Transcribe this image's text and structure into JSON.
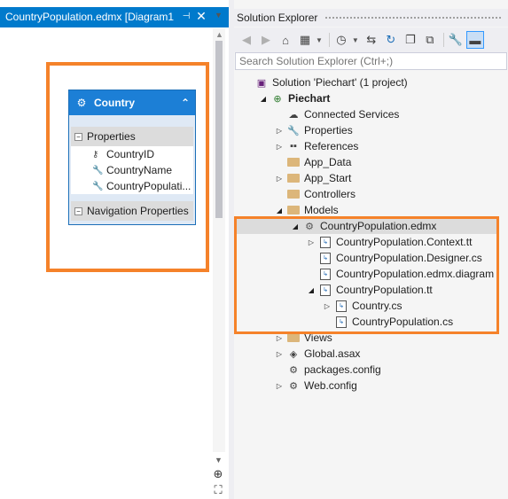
{
  "designer": {
    "tab_title": "CountryPopulation.edmx [Diagram1",
    "pin_icon": "pin-icon",
    "close_label": "✕",
    "entity": {
      "name": "Country",
      "properties_header": "Properties",
      "properties": [
        {
          "name": "CountryID",
          "icon": "key-icon"
        },
        {
          "name": "CountryName",
          "icon": "wrench-icon"
        },
        {
          "name": "CountryPopulati...",
          "icon": "wrench-icon"
        }
      ],
      "navigation_header": "Navigation Properties"
    },
    "highlight_color": "#f5822a"
  },
  "solution_explorer": {
    "title": "Solution Explorer",
    "search_placeholder": "Search Solution Explorer (Ctrl+;)",
    "toolbar": [
      "back-icon",
      "forward-icon",
      "home-icon",
      "switch-views-icon",
      "pending-changes-icon",
      "sync-icon",
      "refresh-icon",
      "collapse-all-icon",
      "show-all-files-icon",
      "properties-icon",
      "preview-icon"
    ],
    "tree": [
      {
        "label": "Solution 'Piechart' (1 project)",
        "icon": "solution-icon",
        "expander": "",
        "bold": false
      },
      {
        "label": "Piechart",
        "icon": "web-project-icon",
        "expander": "◢",
        "bold": true
      },
      {
        "label": "Connected Services",
        "icon": "cloud-icon",
        "expander": "",
        "bold": false
      },
      {
        "label": "Properties",
        "icon": "wrench-icon",
        "expander": "▷",
        "bold": false
      },
      {
        "label": "References",
        "icon": "references-icon",
        "expander": "▷",
        "bold": false
      },
      {
        "label": "App_Data",
        "icon": "folder-icon",
        "expander": "",
        "bold": false
      },
      {
        "label": "App_Start",
        "icon": "folder-icon",
        "expander": "▷",
        "bold": false
      },
      {
        "label": "Controllers",
        "icon": "folder-icon",
        "expander": "",
        "bold": false
      },
      {
        "label": "Models",
        "icon": "folder-icon",
        "expander": "◢",
        "bold": false
      },
      {
        "label": "CountryPopulation.edmx",
        "icon": "edmx-icon",
        "expander": "◢",
        "bold": false
      },
      {
        "label": "CountryPopulation.Context.tt",
        "icon": "template-icon",
        "expander": "▷",
        "bold": false
      },
      {
        "label": "CountryPopulation.Designer.cs",
        "icon": "template-icon",
        "expander": "",
        "bold": false
      },
      {
        "label": "CountryPopulation.edmx.diagram",
        "icon": "template-icon",
        "expander": "",
        "bold": false
      },
      {
        "label": "CountryPopulation.tt",
        "icon": "template-icon",
        "expander": "◢",
        "bold": false
      },
      {
        "label": "Country.cs",
        "icon": "template-icon",
        "expander": "▷",
        "bold": false
      },
      {
        "label": "CountryPopulation.cs",
        "icon": "template-icon",
        "expander": "",
        "bold": false
      },
      {
        "label": "Views",
        "icon": "folder-icon",
        "expander": "▷",
        "bold": false
      },
      {
        "label": "Global.asax",
        "icon": "global-asax-icon",
        "expander": "▷",
        "bold": false
      },
      {
        "label": "packages.config",
        "icon": "config-icon",
        "expander": "",
        "bold": false
      },
      {
        "label": "Web.config",
        "icon": "config-icon",
        "expander": "▷",
        "bold": false
      }
    ],
    "highlight_color": "#f5822a"
  }
}
